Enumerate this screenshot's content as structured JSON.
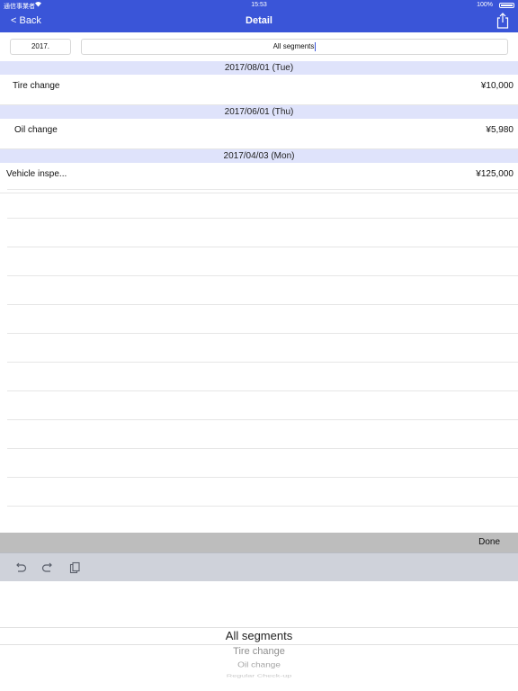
{
  "status_bar": {
    "carrier": "通信事業者",
    "time": "15:53",
    "battery": "100%",
    "wifi_icon": "wifi-icon",
    "battery_icon": "battery-icon"
  },
  "nav": {
    "back_label": "< Back",
    "title": "Detail",
    "share_icon": "share-icon",
    "color": "#3a55d8"
  },
  "filter": {
    "year": "2017.",
    "segment": "All segments"
  },
  "sections": [
    {
      "date": "2017/08/01 (Tue)",
      "items": [
        {
          "name": "Tire change",
          "amount": "¥10,000"
        }
      ]
    },
    {
      "date": "2017/06/01 (Thu)",
      "items": [
        {
          "name": "Oil change",
          "amount": "¥5,980"
        }
      ]
    },
    {
      "date": "2017/04/03 (Mon)",
      "items": [
        {
          "name": "Vehicle inspe...",
          "amount": "¥125,000"
        }
      ]
    }
  ],
  "accessory": {
    "done_label": "Done"
  },
  "toolbar": {
    "undo_icon": "undo-icon",
    "redo_icon": "redo-icon",
    "paste_icon": "paste-icon"
  },
  "picker": {
    "options": [
      "All segments",
      "Tire change",
      "Oil change",
      "Regular Check-up"
    ],
    "selected": "All segments"
  }
}
